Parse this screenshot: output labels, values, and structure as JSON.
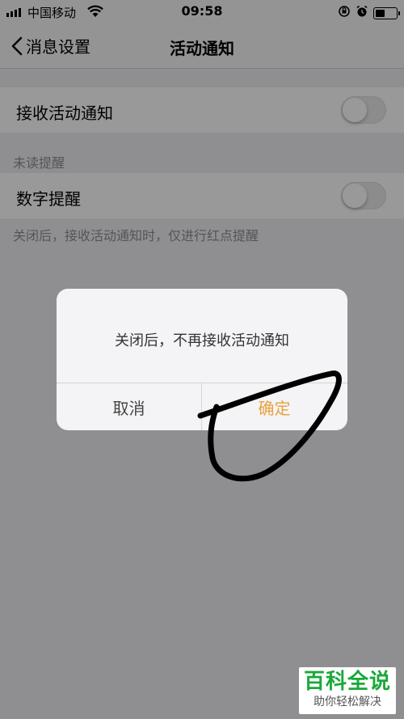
{
  "status_bar": {
    "carrier": "中国移动",
    "time": "09:58"
  },
  "nav": {
    "back_label": "消息设置",
    "title": "活动通知"
  },
  "settings": {
    "receive_activity_label": "接收活动通知",
    "receive_activity_on": false,
    "unread_section_title": "未读提醒",
    "number_reminder_label": "数字提醒",
    "number_reminder_on": false,
    "footer_note": "关闭后，接收活动通知时，仅进行红点提醒"
  },
  "dialog": {
    "message": "关闭后，不再接收活动通知",
    "cancel_label": "取消",
    "confirm_label": "确定"
  },
  "watermark": {
    "top": "百科全说",
    "bottom": "助你轻松解决"
  },
  "colors": {
    "accent": "#e8a23a",
    "watermark_green": "#1aa83a"
  }
}
